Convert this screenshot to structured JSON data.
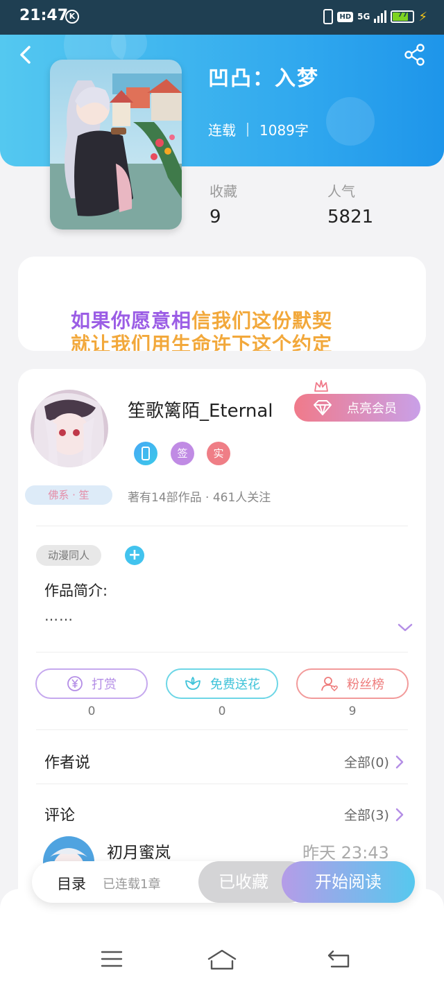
{
  "status_bar": {
    "time": "21:47",
    "k_badge": "K",
    "hd": "HD",
    "network": "5G",
    "battery": "77"
  },
  "book": {
    "title": "凹凸：入梦",
    "status": "连载",
    "word_count": "1089字",
    "favorites_label": "收藏",
    "favorites_value": "9",
    "popularity_label": "人气",
    "popularity_value": "5821"
  },
  "quote": {
    "line1_a": "如果你愿意相",
    "line1_b": "信我们这份默契",
    "line2": "就让我们用生命许下这个约定"
  },
  "author": {
    "name": "笙歌篱陌_Eternal",
    "vip_label": "点亮会员",
    "badges": [
      "签",
      "实"
    ],
    "tag": "佛系 · 笙",
    "meta": "著有14部作品 · 461人关注"
  },
  "work": {
    "genre_tag": "动漫同人",
    "add_tag": "+",
    "intro_label": "作品简介:",
    "intro_text": "……"
  },
  "actions": [
    {
      "label": "打赏",
      "count": "0",
      "color": "#b48ee6"
    },
    {
      "label": "免费送花",
      "count": "0",
      "color": "#4ccbe0"
    },
    {
      "label": "粉丝榜",
      "count": "9",
      "color": "#ee7b7b"
    }
  ],
  "author_says": {
    "title": "作者说",
    "more": "全部(0)"
  },
  "comments": {
    "title": "评论",
    "more": "全部(3)",
    "first_user": "初月蜜岚",
    "first_time": "昨天  23:43"
  },
  "bottom_bar": {
    "toc": "目录",
    "toc_sub": "已连载1章",
    "collected": "已收藏",
    "read": "开始阅读"
  },
  "colors": {
    "header_start": "#54c8f0",
    "header_end": "#1e95ea",
    "vip_start": "#f07a8a",
    "vip_end": "#c9a0e8",
    "read_start": "#b59ce8",
    "read_end": "#56c8ee"
  },
  "icons": [
    "back-icon",
    "share-icon",
    "crown-icon",
    "diamond-icon",
    "phone-badge-icon",
    "yuan-icon",
    "flower-icon",
    "fans-icon",
    "chevron-right-icon",
    "chevron-down-icon",
    "menu-icon",
    "home-icon",
    "return-icon"
  ]
}
